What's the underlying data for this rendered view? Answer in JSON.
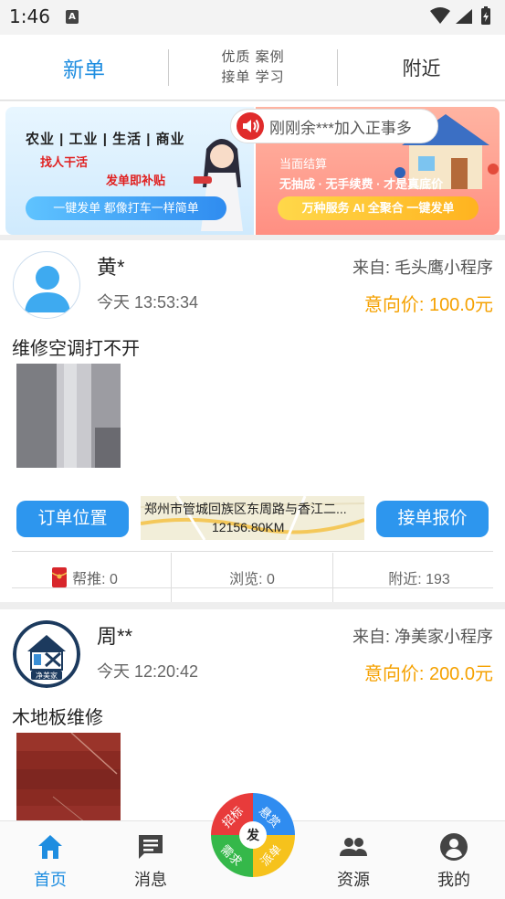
{
  "status_bar": {
    "time": "1:46",
    "badge": "A"
  },
  "top_tabs": {
    "new_orders": "新单",
    "featured_line1": "优质 案例",
    "featured_line2": "接单 学习",
    "nearby": "附近"
  },
  "banner": {
    "categories": "农业 | 工业 | 生活 | 商业",
    "find_workers": "找人干活",
    "post_bonus": "发单即补贴",
    "left_button": "一键发单 都像打车一样简单",
    "pay_on_site": "当面结算",
    "no_fee": "无抽成 · 无手续费 · 才是真底价",
    "right_button": "万种服务 AI 全聚合 一键发单"
  },
  "toast": {
    "text": "刚刚余***加入正事多"
  },
  "orders": [
    {
      "name": "黄*",
      "time": "今天 13:53:34",
      "source": "来自: 毛头鹰小程序",
      "price": "意向价: 100.0元",
      "title": "维修空调打不开",
      "location_button": "订单位置",
      "address": "郑州市管城回族区东周路与香江二...",
      "distance": "12156.80KM",
      "quote_button": "接单报价",
      "boost": "帮推: 0",
      "views": "浏览: 0",
      "nearby": "附近: 193"
    },
    {
      "name": "周**",
      "time": "今天 12:20:42",
      "source": "来自: 净美家小程序",
      "price": "意向价: 200.0元",
      "title": "木地板维修",
      "logo_text": "净美家"
    }
  ],
  "bottom_nav": {
    "home": "首页",
    "messages": "消息",
    "resources": "资源",
    "mine": "我的"
  },
  "fab": {
    "center": "发",
    "q1": "招标",
    "q2": "悬赏",
    "q3": "派单",
    "q4": "需求"
  },
  "colors": {
    "accent": "#1e8de0",
    "button_blue": "#2d96ee",
    "price_orange": "#f5a100",
    "fab_red": "#e83b3b",
    "fab_blue": "#2f8cf0",
    "fab_yellow": "#f6c21c",
    "fab_green": "#35b84a"
  }
}
